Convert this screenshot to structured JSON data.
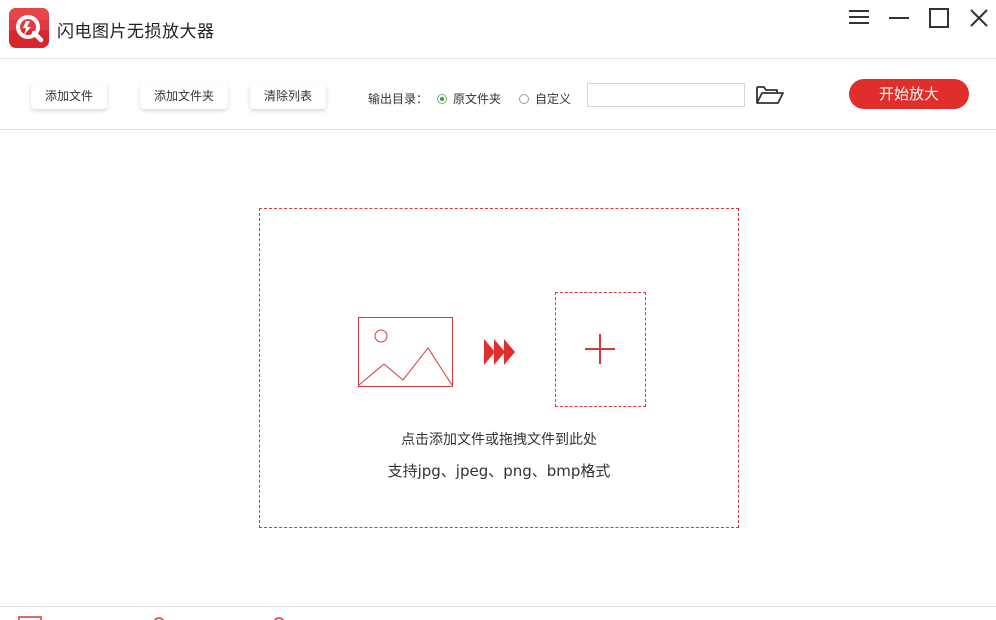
{
  "app": {
    "title": "闪电图片无损放大器"
  },
  "toolbar": {
    "add_file": "添加文件",
    "add_folder": "添加文件夹",
    "clear_list": "清除列表",
    "output_label": "输出目录：",
    "radio_original": "原文件夹",
    "radio_custom": "自定义",
    "selected": "原文件夹",
    "path_value": "",
    "start": "开始放大"
  },
  "dropzone": {
    "hint_primary": "点击添加文件或拖拽文件到此处",
    "hint_formats": "支持jpg、jpeg、png、bmp格式"
  },
  "icons": [
    "app-logo-icon",
    "menu-icon",
    "minimize-icon",
    "maximize-icon",
    "close-icon",
    "folder-open-icon",
    "image-icon",
    "triple-arrow-icon",
    "plus-icon"
  ],
  "colors": {
    "accent": "#e02f2a",
    "dash_border": "#d9383a",
    "radio_selected": "#2aa33a"
  }
}
